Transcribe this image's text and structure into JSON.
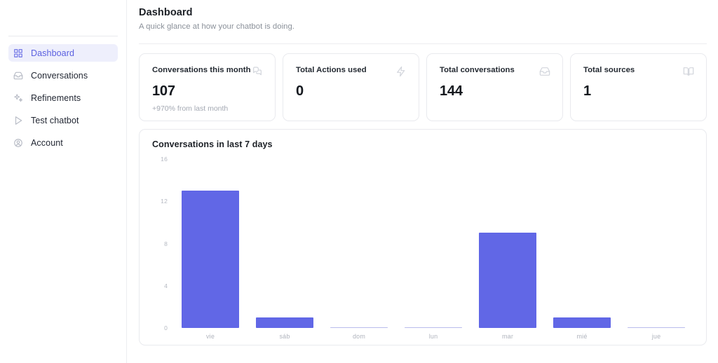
{
  "sidebar": {
    "items": [
      {
        "label": "Dashboard",
        "icon": "grid-icon",
        "active": true
      },
      {
        "label": "Conversations",
        "icon": "inbox-icon",
        "active": false
      },
      {
        "label": "Refinements",
        "icon": "sparkle-icon",
        "active": false
      },
      {
        "label": "Test chatbot",
        "icon": "play-icon",
        "active": false
      },
      {
        "label": "Account",
        "icon": "user-circle-icon",
        "active": false
      }
    ]
  },
  "header": {
    "title": "Dashboard",
    "subtitle": "A quick glance at how your chatbot is doing."
  },
  "cards": [
    {
      "label": "Conversations this month",
      "value": "107",
      "delta": "+970% from last month",
      "icon": "chat-bubbles-icon"
    },
    {
      "label": "Total Actions used",
      "value": "0",
      "delta": "",
      "icon": "lightning-bolt-icon"
    },
    {
      "label": "Total conversations",
      "value": "144",
      "delta": "",
      "icon": "inbox-icon"
    },
    {
      "label": "Total sources",
      "value": "1",
      "delta": "",
      "icon": "open-book-icon"
    }
  ],
  "chart_data": {
    "type": "bar",
    "title": "Conversations in last 7 days",
    "categories": [
      "vie",
      "sáb",
      "dom",
      "lun",
      "mar",
      "mié",
      "jue"
    ],
    "values": [
      13,
      1,
      0,
      0,
      9,
      1,
      0
    ],
    "yticks": [
      "0",
      "4",
      "8",
      "12",
      "16"
    ],
    "ylim": [
      0,
      16
    ],
    "xlabel": "",
    "ylabel": "",
    "grid": false,
    "legend": false,
    "bar_color": "#6167e6"
  },
  "colors": {
    "accent": "#6167e6",
    "accent_soft": "#eeeffc",
    "border": "#e9eaee",
    "text": "#1c2026",
    "muted": "#8a9099"
  }
}
